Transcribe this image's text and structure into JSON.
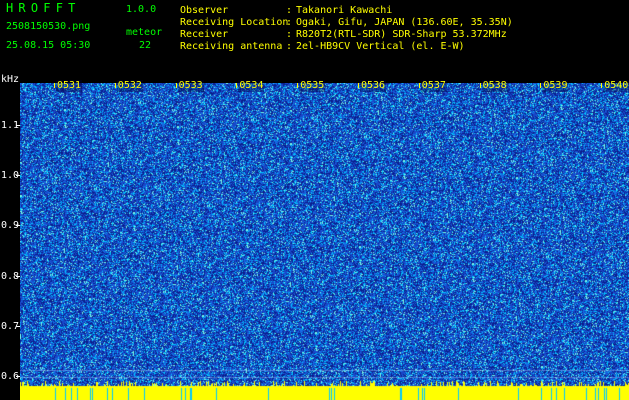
{
  "header": {
    "app_name": "HROFFT",
    "version": "1.0.0",
    "file_name": "2508150530.png",
    "meteor_label": "meteor",
    "date_time": "25.08.15 05:30",
    "meteor_count": "22",
    "fields": [
      {
        "label": "Observer",
        "value": "Takanori Kawachi"
      },
      {
        "label": "Receiving Location",
        "value": "Ogaki, Gifu, JAPAN (136.60E, 35.35N)"
      },
      {
        "label": "Receiver",
        "value": "R820T2(RTL-SDR) SDR-Sharp 53.372MHz"
      },
      {
        "label": "Receiving antenna",
        "value": "2el-HB9CV Vertical (el. E-W)"
      }
    ]
  },
  "spectrogram": {
    "unit": "kHz",
    "y_ticks": [
      "1.1",
      "1.0",
      "0.9",
      "0.8",
      "0.7",
      "0.6"
    ],
    "x_ticks": [
      "0531",
      "0532",
      "0533",
      "0534",
      "0535",
      "0536",
      "0537",
      "0538",
      "0539",
      "0540"
    ],
    "colors": {
      "background": "#1a3fbf",
      "noise": "#00e5ff",
      "noise_dark": "#0a1f8a",
      "baseline": "#ffff00",
      "labels": "#ffff00"
    }
  }
}
